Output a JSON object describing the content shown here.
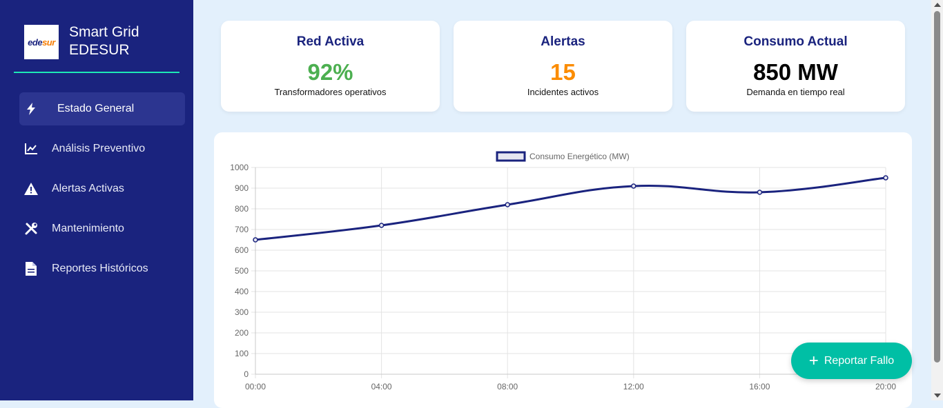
{
  "brand": {
    "line1": "Smart Grid",
    "line2": "EDESUR",
    "logo_ede": "ede",
    "logo_sur": "sur"
  },
  "nav": [
    {
      "label": "Estado General",
      "icon": "bolt-icon",
      "active": true
    },
    {
      "label": "Análisis Preventivo",
      "icon": "chart-line-icon",
      "active": false
    },
    {
      "label": "Alertas Activas",
      "icon": "warning-icon",
      "active": false
    },
    {
      "label": "Mantenimiento",
      "icon": "tools-icon",
      "active": false
    },
    {
      "label": "Reportes Históricos",
      "icon": "file-icon",
      "active": false
    }
  ],
  "cards": [
    {
      "title": "Red Activa",
      "value": "92%",
      "subtitle": "Transformadores operativos",
      "value_color": "#4caf50"
    },
    {
      "title": "Alertas",
      "value": "15",
      "subtitle": "Incidentes activos",
      "value_color": "#fb8c00"
    },
    {
      "title": "Consumo Actual",
      "value": "850 MW",
      "subtitle": "Demanda en tiempo real",
      "value_color": "#000000"
    }
  ],
  "fab": {
    "label": "Reportar Fallo",
    "icon": "plus-icon"
  },
  "colors": {
    "sidebar": "#1a237e",
    "accent": "#1de9b6",
    "fab": "#00bfa5",
    "line": "#1a237e"
  },
  "chart_data": {
    "type": "line",
    "x": [
      "00:00",
      "04:00",
      "08:00",
      "12:00",
      "16:00",
      "20:00"
    ],
    "series": [
      {
        "name": "Consumo Energético (MW)",
        "values": [
          650,
          720,
          820,
          910,
          880,
          950
        ]
      }
    ],
    "ylim": [
      0,
      1000
    ],
    "yticks": [
      0,
      100,
      200,
      300,
      400,
      500,
      600,
      700,
      800,
      900,
      1000
    ],
    "grid": true,
    "legend": "top-center"
  }
}
